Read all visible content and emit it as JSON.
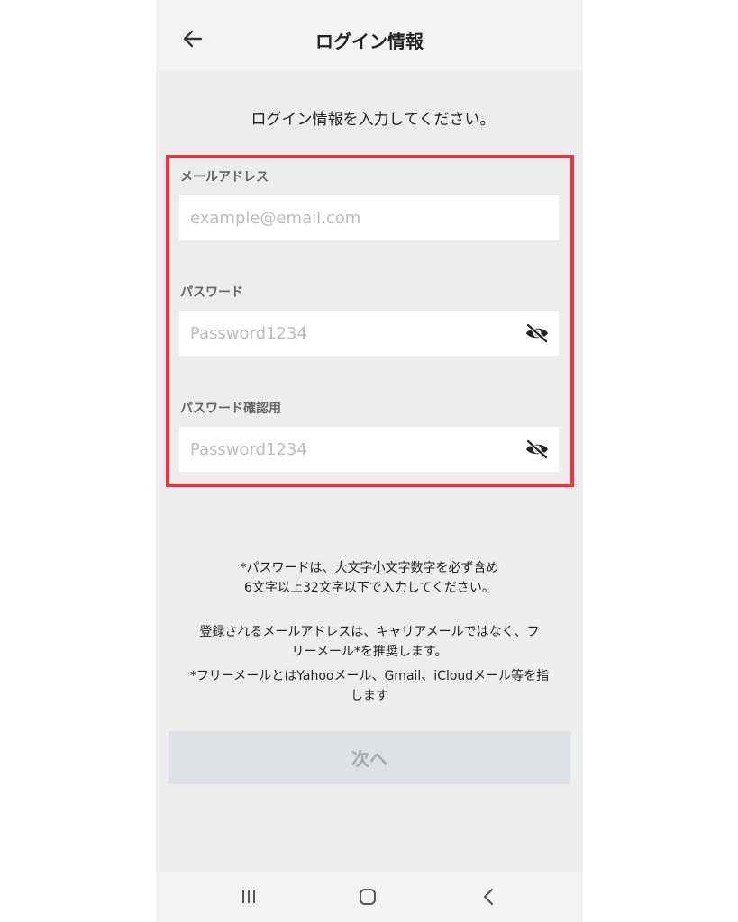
{
  "header": {
    "title": "ログイン情報",
    "back_icon": "arrow-left-icon"
  },
  "intro_text": "ログイン情報を入力してください。",
  "form": {
    "email": {
      "label": "メールアドレス",
      "placeholder": "example@email.com",
      "value": ""
    },
    "password": {
      "label": "パスワード",
      "placeholder": "Password1234",
      "value": "",
      "toggle_icon": "eye-slash-icon"
    },
    "password_confirm": {
      "label": "パスワード確認用",
      "placeholder": "Password1234",
      "value": "",
      "toggle_icon": "eye-slash-icon"
    },
    "highlight_color": "#f2323a"
  },
  "notes": {
    "password_rule": [
      "*パスワードは、大文字小文字数字を必ず含め",
      "6文字以上32文字以下で入力してください。"
    ],
    "email_recommendation": [
      "登録されるメールアドレスは、キャリアメールではなく、フ",
      "リーメール*を推奨します。"
    ],
    "free_mail_definition": [
      "*フリーメールとはYahooメール、Gmail、iCloudメール等を指",
      "します"
    ]
  },
  "next_button": {
    "label": "次へ",
    "enabled": false
  },
  "system_nav": {
    "recents_icon": "recent-apps-icon",
    "home_icon": "home-icon",
    "back_icon": "back-chevron-icon"
  }
}
